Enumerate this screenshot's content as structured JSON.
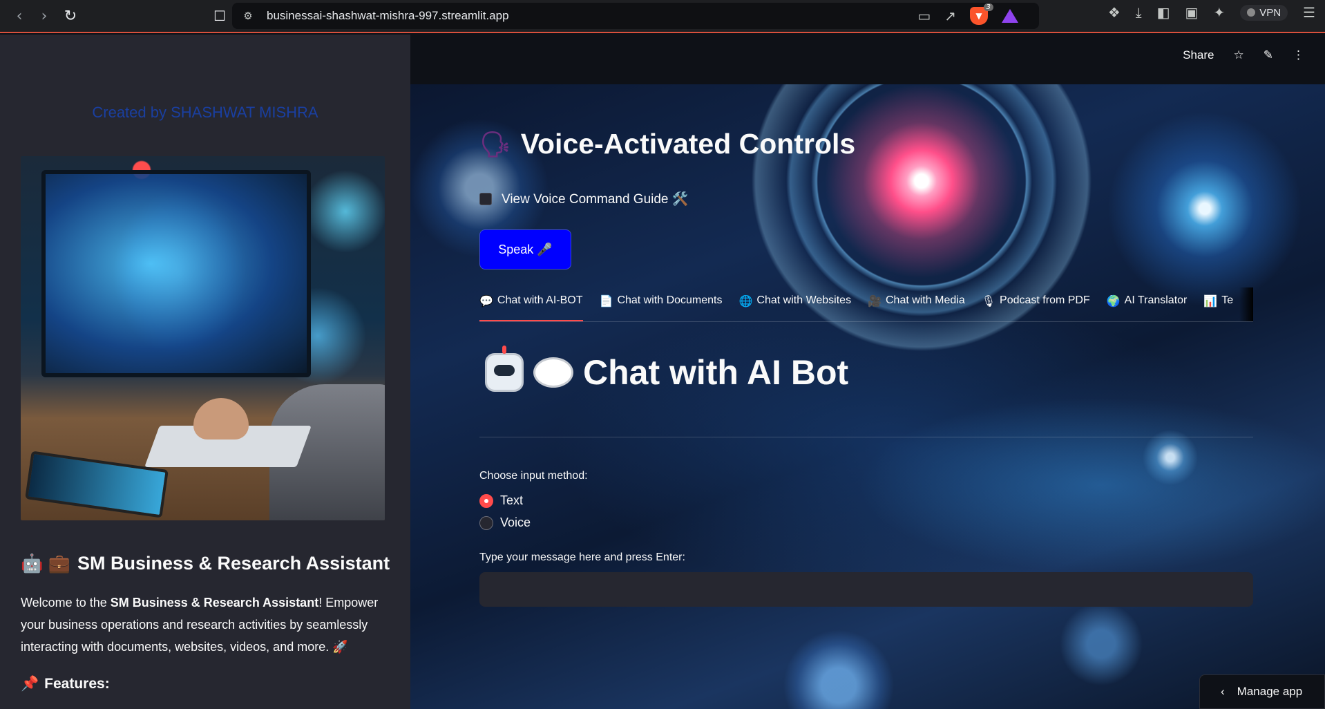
{
  "browser": {
    "url": "businessai-shashwat-mishra-997.streamlit.app",
    "brave_badge": "3",
    "vpn_label": "VPN",
    "icons": [
      "back-icon",
      "forward-icon",
      "reload-icon",
      "bookmark-icon",
      "site-info-icon",
      "cast-icon",
      "share-icon",
      "brave-shields-icon",
      "brave-rewards-icon",
      "extensions-icon",
      "download-icon",
      "sidebar-icon",
      "wallet-icon",
      "leo-ai-icon",
      "menu-icon"
    ]
  },
  "sidebar": {
    "created_by": "Created by SHASHWAT MISHRA",
    "title_emoji": "🤖 💼",
    "title": "SM Business & Research Assistant",
    "welcome_prefix": "Welcome to the ",
    "welcome_bold": "SM Business & Research Assistant",
    "welcome_suffix": "! Empower your business operations and research activities by seamlessly interacting with documents, websites, videos, and more. 🚀",
    "features_emoji": "📌",
    "features_label": "Features:"
  },
  "header": {
    "share_label": "Share"
  },
  "main": {
    "voice_emoji": "🗣",
    "voice_title": "Voice-Activated Controls",
    "guide_label": "View Voice Command Guide 🛠️",
    "speak_label": "Speak 🎤",
    "tabs": [
      {
        "icon": "💬",
        "label": "Chat with AI-BOT"
      },
      {
        "icon": "📄",
        "label": "Chat with Documents"
      },
      {
        "icon": "🌐",
        "label": "Chat with Websites"
      },
      {
        "icon": "🎥",
        "label": "Chat with Media"
      },
      {
        "icon": "🎙",
        "label": "Podcast from PDF"
      },
      {
        "icon": "🌍",
        "label": "AI Translator"
      },
      {
        "icon": "📊",
        "label": "Te"
      }
    ],
    "chat_title": "Chat with AI Bot",
    "choose_label": "Choose input method:",
    "radio_options": [
      "Text",
      "Voice"
    ],
    "selected_option": "Text",
    "msg_label": "Type your message here and press Enter:",
    "msg_value": ""
  },
  "manage_app": "Manage app",
  "colors": {
    "accent": "#ff4b4b",
    "speak_button": "#0000ff",
    "created_by": "#1a3fa0",
    "sidebar_bg": "#262730"
  }
}
